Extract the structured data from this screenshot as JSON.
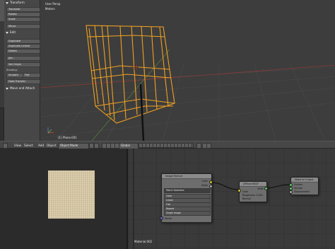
{
  "toolshelf": {
    "transform_header": "Transform",
    "translate": "Translate",
    "rotate": "Rotate",
    "scale": "Scale",
    "mirror": "Mirror",
    "edit_header": "Edit",
    "duplicate": "Duplicate",
    "duplicate_linked": "Duplicate Linked",
    "delete": "Delete",
    "join": "Join",
    "set_origin": "Set Origin",
    "shading_label": "Shading:",
    "smooth": "Smooth",
    "flat": "Flat",
    "data_transfer": "Data Transfer",
    "history_header": "Move and Attach"
  },
  "viewport": {
    "title": "User Persp",
    "units": "Meters",
    "object_name": "(1) Plane.001"
  },
  "header3d": {
    "view": "View",
    "select": "Select",
    "add": "Add",
    "object": "Object",
    "mode": "Object Mode",
    "pivot": "Global"
  },
  "node_editor": {
    "image_texture_title": "Image Texture",
    "color_out": "Color",
    "alpha_out": "Alpha",
    "image_field": "Fabric Seamless",
    "rows": [
      "Color",
      "Linear",
      "Flat",
      "Repeat",
      "Single Image"
    ],
    "vector_in": "Vector",
    "diffuse_title": "Diffuse BSDF",
    "bsdf_out": "BSDF",
    "diffuse_color": "Color",
    "roughness": "Roughness: 0.000",
    "normal": "Normal",
    "output_title": "Material Output",
    "surface": "Surface",
    "volume": "Volume",
    "displacement": "Displacement",
    "material_name": "Material.002"
  },
  "colors": {
    "selection": "#f0a020",
    "viewport_bg": "#3d3d3d",
    "socket_color": "#c7c729",
    "socket_shader": "#63c763",
    "socket_vector": "#6363c7"
  }
}
